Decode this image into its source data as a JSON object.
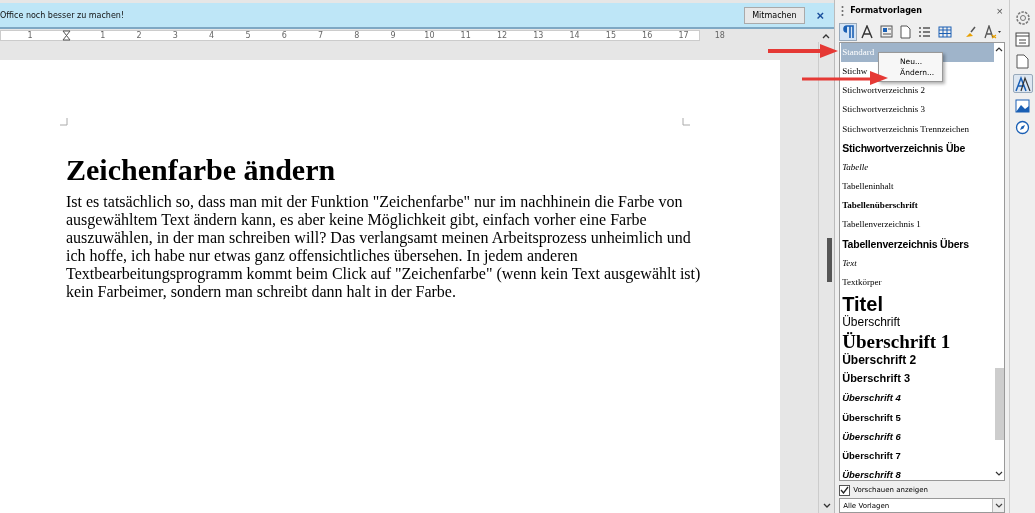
{
  "infobar": {
    "message": "Office noch besser zu machen!",
    "button": "Mitmachen",
    "close": "×"
  },
  "ruler": {
    "left_label": "1",
    "labels": [
      "1",
      "2",
      "3",
      "4",
      "5",
      "6",
      "7",
      "8",
      "9",
      "10",
      "11",
      "12",
      "13",
      "14",
      "15",
      "16",
      "17",
      "18"
    ]
  },
  "document": {
    "heading": "Zeichenfarbe ändern",
    "paragraph": "Ist es tatsächlich so, dass man mit der Funktion \"Zeichenfarbe\" nur im nachhinein die Farbe von ausgewähltem Text ändern kann, es aber keine Möglichkeit gibt, einfach vorher eine Farbe auszuwählen, in der man schreiben will? Das verlangsamt meinen Arbeitsprozess unheimlich und ich hoffe, ich habe nur etwas ganz offensichtliches übersehen. In jedem anderen Textbearbeitungsprogramm kommt beim Click auf \"Zeichenfarbe\" (wenn kein Text ausgewählt ist) kein Farbeimer, sondern man schreibt dann halt in der Farbe."
  },
  "sidebar": {
    "title": "Formatvorlagen",
    "close": "×",
    "styles": [
      {
        "label": "Standard",
        "kind": "serif",
        "selected": true
      },
      {
        "label": "Stichw",
        "kind": "serif",
        "selected": false
      },
      {
        "label": "Stichwortverzeichnis 2",
        "kind": "serif",
        "selected": false
      },
      {
        "label": "Stichwortverzeichnis 3",
        "kind": "serif",
        "selected": false
      },
      {
        "label": "Stichwortverzeichnis Trennzeichen",
        "kind": "serif",
        "selected": false
      },
      {
        "label": "Stichwortverzeichnis Übe",
        "kind": "sans-large",
        "selected": false
      },
      {
        "label": "Tabelle",
        "kind": "serif-italic",
        "selected": false
      },
      {
        "label": "Tabelleninhalt",
        "kind": "serif",
        "selected": false
      },
      {
        "label": "Tabellenüberschrift",
        "kind": "serif-bold",
        "selected": false
      },
      {
        "label": "Tabellenverzeichnis 1",
        "kind": "serif",
        "selected": false
      },
      {
        "label": "Tabellenverzeichnis Übers",
        "kind": "sans-large",
        "selected": false
      },
      {
        "label": "Text",
        "kind": "serif-italic",
        "selected": false
      },
      {
        "label": "Textkörper",
        "kind": "serif",
        "selected": false
      },
      {
        "label": "Titel",
        "kind": "title",
        "selected": false
      },
      {
        "label": "Überschrift",
        "kind": "sans-plain",
        "selected": false
      },
      {
        "label": "Überschrift 1",
        "kind": "serif-huge",
        "selected": false
      },
      {
        "label": "Überschrift 2",
        "kind": "sans-h2",
        "selected": false
      },
      {
        "label": "Überschrift 3",
        "kind": "sans-h3",
        "selected": false
      },
      {
        "label": "Überschrift 4",
        "kind": "sans-italic",
        "selected": false
      },
      {
        "label": "Überschrift 5",
        "kind": "sans-bold",
        "selected": false
      },
      {
        "label": "Überschrift 6",
        "kind": "sans-italic",
        "selected": false
      },
      {
        "label": "Überschrift 7",
        "kind": "sans-bold",
        "selected": false
      },
      {
        "label": "Überschrift 8",
        "kind": "sans-italic",
        "selected": false
      }
    ],
    "context_menu": [
      "Neu...",
      "Ändern..."
    ],
    "show_previews": {
      "label": "Vorschauen anzeigen",
      "checked": true
    },
    "filter": {
      "value": "Alle Vorlagen"
    }
  }
}
